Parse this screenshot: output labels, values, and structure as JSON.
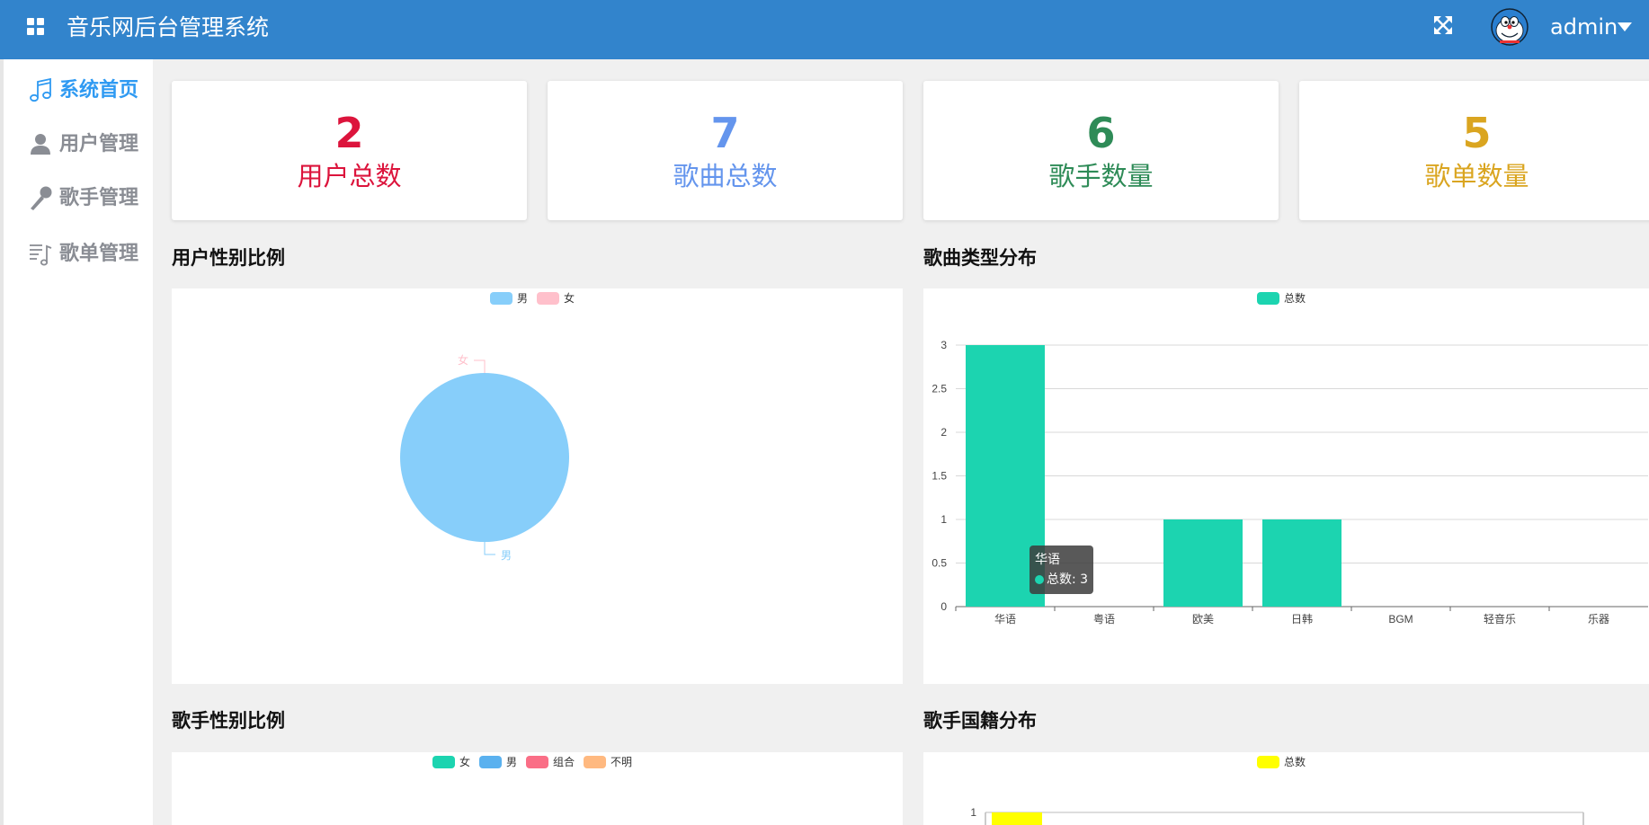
{
  "header": {
    "title": "音乐网后台管理系统",
    "user": "admin"
  },
  "sidebar": {
    "items": [
      {
        "label": "系统首页",
        "icon": "music-note-icon"
      },
      {
        "label": "用户管理",
        "icon": "user-icon"
      },
      {
        "label": "歌手管理",
        "icon": "microphone-icon"
      },
      {
        "label": "歌单管理",
        "icon": "playlist-icon"
      }
    ]
  },
  "stats": [
    {
      "value": "2",
      "label": "用户总数",
      "color": "#dc143c"
    },
    {
      "value": "7",
      "label": "歌曲总数",
      "color": "#6495ed"
    },
    {
      "value": "6",
      "label": "歌手数量",
      "color": "#2e8b57"
    },
    {
      "value": "5",
      "label": "歌单数量",
      "color": "#daa520"
    }
  ],
  "sections": {
    "user_gender": "用户性别比例",
    "song_type": "歌曲类型分布",
    "singer_gender": "歌手性别比例",
    "singer_country": "歌手国籍分布"
  },
  "tooltip": {
    "title": "华语",
    "line": "总数: 3"
  },
  "chart_data": [
    {
      "type": "pie",
      "labels": [
        "男",
        "女"
      ],
      "values": [
        2,
        0
      ],
      "colors": [
        "#87cefa",
        "#ffc0cb"
      ],
      "legend": "top-center"
    },
    {
      "type": "bar",
      "categories": [
        "华语",
        "粤语",
        "欧美",
        "日韩",
        "BGM",
        "轻音乐",
        "乐器"
      ],
      "series": [
        {
          "name": "总数",
          "values": [
            3,
            0,
            1,
            1,
            0,
            0,
            0
          ]
        }
      ],
      "color": "#1cd4b0",
      "yticks": [
        "0",
        "0.5",
        "1",
        "1.5",
        "2",
        "2.5",
        "3"
      ],
      "ylim": [
        0,
        3
      ],
      "grid": true,
      "legend": "top-center"
    },
    {
      "type": "pie",
      "labels": [
        "女",
        "男",
        "组合",
        "不明"
      ],
      "colors": [
        "#1cd4b0",
        "#5ab1ef",
        "#fa6e86",
        "#ffb980"
      ],
      "legend": "top-center"
    },
    {
      "type": "bar",
      "series": [
        {
          "name": "总数"
        }
      ],
      "color": "#ffff00",
      "yticks": [
        "1"
      ],
      "legend": "top-center"
    }
  ]
}
